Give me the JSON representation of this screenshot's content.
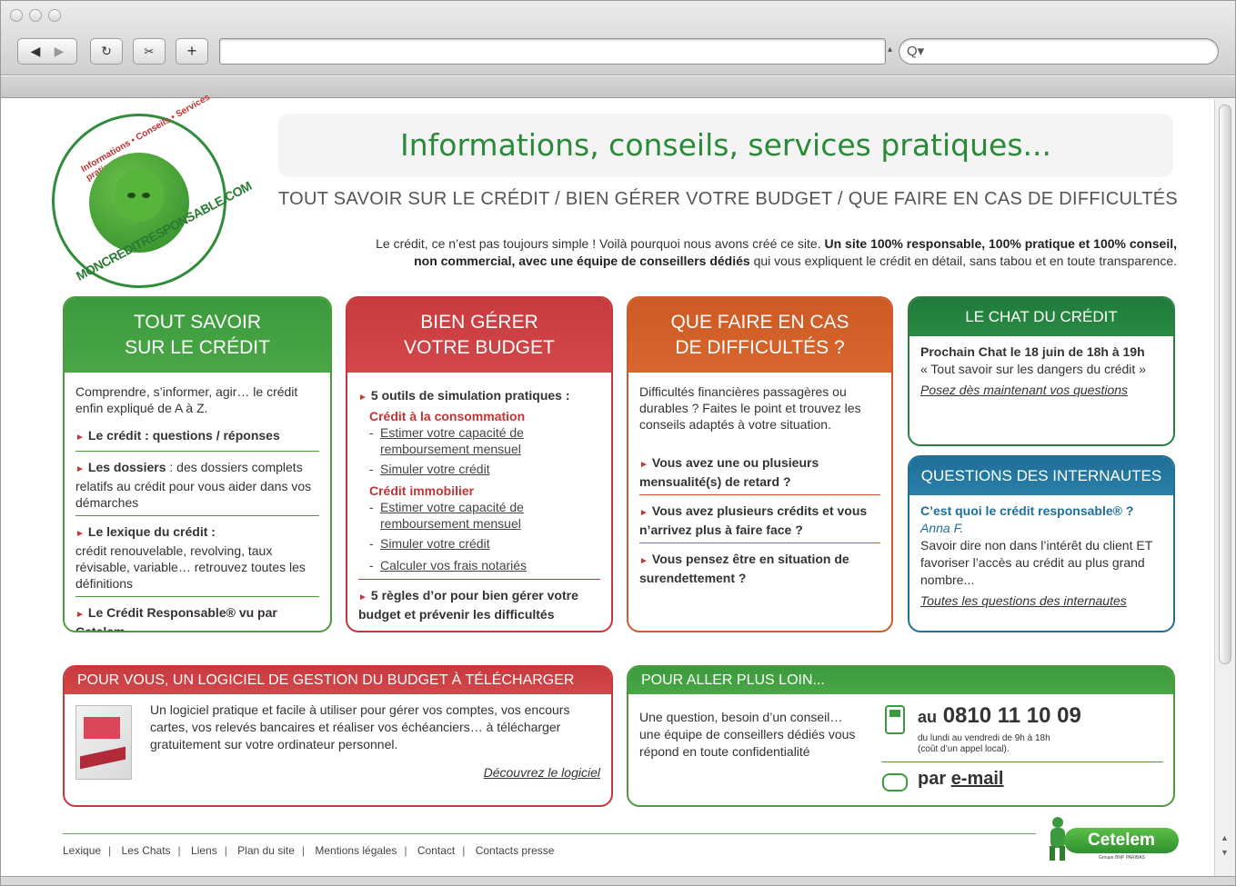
{
  "browser": {
    "search_placeholder": "Q▾"
  },
  "logo": {
    "ring_top": "Informations • Conseils • Services pratiques",
    "ring_bottom": "MONCREDITRESPONSABLE.COM"
  },
  "banner": "Informations, conseils, services pratiques...",
  "subtitle": "TOUT SAVOIR SUR LE CRÉDIT / BIEN GÉRER VOTRE BUDGET / QUE FAIRE EN CAS DE DIFFICULTÉS",
  "intro": {
    "part1": "Le crédit, ce n’est pas toujours simple ! Voilà pourquoi nous avons créé ce site. ",
    "bold1": "Un site 100% responsable, 100% pratique et 100% conseil,",
    "bold2": "non commercial, avec une équipe de conseillers dédiés",
    "part2": " qui vous expliquent le crédit en détail, sans tabou et en toute transparence."
  },
  "col1": {
    "title_line1": "TOUT SAVOIR",
    "title_line2": "SUR LE CRÉDIT",
    "intro": "Comprendre, s’informer, agir… le crédit enfin expliqué de A à Z.",
    "item1": "Le crédit : questions / réponses",
    "item2_bold": "Les dossiers",
    "item2_rest": " : des dossiers complets relatifs au crédit pour vous aider dans vos démarches",
    "item3_bold": "Le lexique du crédit :",
    "item3_rest": "crédit renouvelable, revolving, taux révisable, variable… retrouvez toutes les définitions",
    "item4": "Le Crédit Responsable® vu par Cetelem"
  },
  "col2": {
    "title_line1": "BIEN GÉRER",
    "title_line2": "VOTRE BUDGET",
    "tools": "5 outils de simulation pratiques :",
    "conso_title": "Crédit à la consommation",
    "conso_link1": "Estimer votre capacité de remboursement mensuel",
    "conso_link2": "Simuler votre crédit",
    "immo_title": "Crédit immobilier",
    "immo_link1": "Estimer votre capacité de remboursement mensuel",
    "immo_link2": "Simuler votre crédit",
    "immo_link3": "Calculer vos frais notariés",
    "rules": "5 règles d’or pour bien gérer votre budget et prévenir les difficultés"
  },
  "col3": {
    "title_line1": "QUE FAIRE EN CAS",
    "title_line2": "DE DIFFICULTÉS ?",
    "intro": "Difficultés financières passagères ou durables ? Faites le point et trouvez les conseils adaptés à votre situation.",
    "item1": "Vous avez une ou plusieurs mensualité(s) de retard ?",
    "item2": "Vous avez plusieurs crédits et vous n’arrivez plus à faire face ?",
    "item3": "Vous pensez être en situation de surendettement ?"
  },
  "chat": {
    "title": "LE CHAT DU CRÉDIT",
    "next": "Prochain Chat le 18 juin de 18h à 19h",
    "topic": "« Tout savoir sur les dangers du crédit »",
    "link": "Posez dès maintenant vos questions"
  },
  "questions": {
    "title": "QUESTIONS DES INTERNAUTES",
    "question": "C’est quoi le crédit responsable® ?",
    "author": "Anna F.",
    "answer": "Savoir dire non dans l’intérêt du client ET favoriser l’accès au crédit au plus grand nombre...",
    "link": "Toutes les questions des internautes"
  },
  "software": {
    "title": "POUR VOUS, UN LOGICIEL DE GESTION DU BUDGET À TÉLÉCHARGER",
    "text": "Un logiciel pratique et facile à utiliser pour gérer vos comptes, vos encours cartes, vos relevés bancaires et réaliser vos échéanciers… à télécharger gratuitement sur votre ordinateur personnel.",
    "link": "Découvrez le logiciel"
  },
  "further": {
    "title": "POUR ALLER PLUS LOIN...",
    "text": "Une question, besoin d’un conseil… une équipe de conseillers dédiés vous répond en toute confidentialité",
    "phone_prefix": "au",
    "phone": "0810 11 10 09",
    "hours": "du lundi au vendredi de 9h à 18h",
    "cost": "(coût d’un appel local).",
    "email_prefix": "par",
    "email": "e-mail"
  },
  "footer": {
    "links": [
      "Lexique",
      "Les Chats",
      "Liens",
      "Plan du site",
      "Mentions légales",
      "Contact",
      "Contacts presse"
    ],
    "brand": "Cetelem",
    "brand_sub": "Groupe BNP PARIBAS"
  },
  "colors": {
    "green": "#4d9a3a",
    "red": "#c8383a",
    "orange": "#cf5b2a",
    "dark_green": "#2e7c3f",
    "blue": "#1f7096",
    "banner_text": "#2b8a3a"
  }
}
